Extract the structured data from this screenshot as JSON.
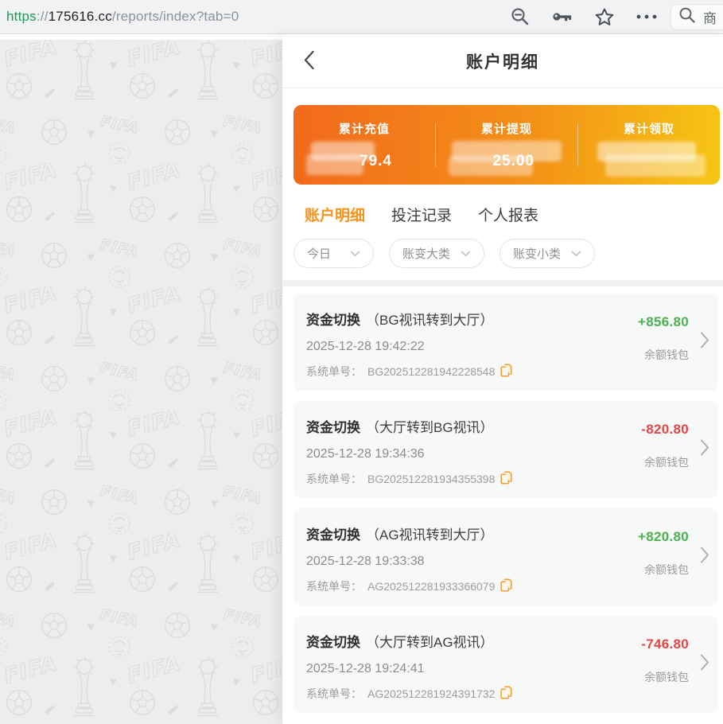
{
  "browser": {
    "scheme": "https",
    "separator": "://",
    "host": "175616.cc",
    "path": "/reports/index?tab=0",
    "side_search_text": "商"
  },
  "header": {
    "title": "账户明细"
  },
  "summary": {
    "items": [
      {
        "label": "累计充值",
        "value_fragment": "79.4"
      },
      {
        "label": "累计提现",
        "value_fragment": "25.00"
      },
      {
        "label": "累计领取",
        "value_fragment": ""
      }
    ]
  },
  "tabs": [
    {
      "label": "账户明细",
      "active": true
    },
    {
      "label": "投注记录",
      "active": false
    },
    {
      "label": "个人报表",
      "active": false
    }
  ],
  "filters": [
    {
      "label": "今日"
    },
    {
      "label": "账变大类"
    },
    {
      "label": "账变小类"
    }
  ],
  "records": [
    {
      "title": "资金切换",
      "subtitle": "（BG视讯转到大厅）",
      "time": "2025-12-28 19:42:22",
      "order_label": "系统单号：",
      "order_no": "BG202512281942228548",
      "amount": "+856.80",
      "wallet": "余额钱包"
    },
    {
      "title": "资金切换",
      "subtitle": "（大厅转到BG视讯）",
      "time": "2025-12-28 19:34:36",
      "order_label": "系统单号：",
      "order_no": "BG202512281934355398",
      "amount": "-820.80",
      "wallet": "余额钱包"
    },
    {
      "title": "资金切换",
      "subtitle": "（AG视讯转到大厅）",
      "time": "2025-12-28 19:33:38",
      "order_label": "系统单号：",
      "order_no": "AG202512281933366079",
      "amount": "+820.80",
      "wallet": "余额钱包"
    },
    {
      "title": "资金切换",
      "subtitle": "（大厅转到AG视讯）",
      "time": "2025-12-28 19:24:41",
      "order_label": "系统单号：",
      "order_no": "AG202512281924391732",
      "amount": "-746.80",
      "wallet": "余额钱包"
    }
  ],
  "colors": {
    "accent": "#f7941e",
    "gradient_from": "#f2691c",
    "gradient_to": "#f6c514",
    "positive": "#4caf50",
    "negative": "#e64545"
  }
}
